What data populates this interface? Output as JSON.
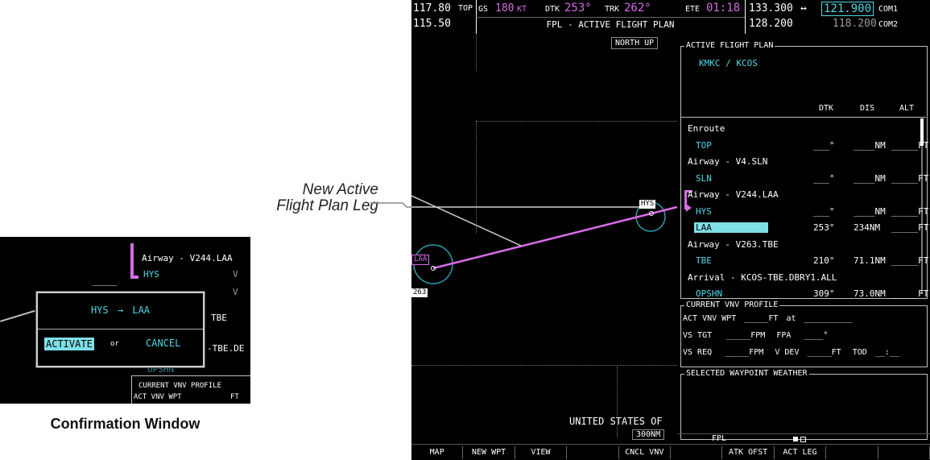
{
  "topbar": {
    "nav1_active": "117.80",
    "nav1_ident": "TOP",
    "nav1_standby": "115.50",
    "gs_label": "GS",
    "gs_value": "180",
    "gs_unit": "KT",
    "dtk_label": "DTK",
    "dtk_value": "253°",
    "trk_label": "TRK",
    "trk_value": "262°",
    "ete_label": "ETE",
    "ete_value": "01:18",
    "page_title": "FPL - ACTIVE FLIGHT PLAN",
    "com1_active": "133.300",
    "swap_symbol": "↔",
    "com1_standby": "121.900",
    "com1_label": "COM1",
    "com2_active": "128.200",
    "com2_standby": "118.200",
    "com2_label": "COM2"
  },
  "map": {
    "orientation": "NORTH UP",
    "region_label": "UNITED STATES OF",
    "range": "300NM",
    "waypoint_hys": "HYS",
    "waypoint_laa": "LAA",
    "airway_263": "263"
  },
  "fpl": {
    "title": "ACTIVE FLIGHT PLAN",
    "route": "KMKC / KCOS",
    "col_dtk": "DTK",
    "col_dis": "DIS",
    "col_alt": "ALT",
    "rows": [
      {
        "kind": "header",
        "name": "Enroute"
      },
      {
        "kind": "wpt",
        "name": "TOP",
        "dtk": "___°",
        "dis": "____NM",
        "alt": "_____FT"
      },
      {
        "kind": "header",
        "name": "Airway - V4.SLN"
      },
      {
        "kind": "wpt",
        "name": "SLN",
        "dtk": "___°",
        "dis": "____NM",
        "alt": "_____FT"
      },
      {
        "kind": "header",
        "name": "Airway - V244.LAA"
      },
      {
        "kind": "wpt",
        "name": "HYS",
        "dtk": "___°",
        "dis": "____NM",
        "alt": "_____FT"
      },
      {
        "kind": "wpt-selected",
        "name": "LAA",
        "dtk": "253°",
        "dis": "234NM",
        "alt": "_____FT"
      },
      {
        "kind": "header",
        "name": "Airway - V263.TBE"
      },
      {
        "kind": "wpt",
        "name": "TBE",
        "dtk": "210°",
        "dis": "71.1NM",
        "alt": "_____FT"
      },
      {
        "kind": "header",
        "name": "Arrival - KCOS-TBE.DBRY1.ALL"
      },
      {
        "kind": "wpt",
        "name": "OPSHN",
        "dtk": "309°",
        "dis": "73.0NM",
        "alt": "_____FT"
      }
    ]
  },
  "vnv": {
    "title": "CURRENT VNV PROFILE",
    "act_vnv_wpt_label": "ACT VNV WPT",
    "act_vnv_wpt_value": "_____FT",
    "at_label": "at",
    "at_value": "__________",
    "vs_tgt_label": "VS TGT",
    "vs_tgt_value": "_____FPM",
    "fpa_label": "FPA",
    "fpa_value": "____°",
    "vs_req_label": "VS REQ",
    "vs_req_value": "_____FPM",
    "vdev_label": "V DEV",
    "vdev_value": "_____FT",
    "tod_label": "TOD",
    "tod_value": "__:__"
  },
  "weather": {
    "title": "SELECTED WAYPOINT WEATHER"
  },
  "status": {
    "mode": "FPL"
  },
  "softkeys": [
    "MAP",
    "NEW WPT",
    "VIEW",
    "",
    "CNCL VNV",
    "",
    "ATK OFST",
    "ACT LEG",
    "",
    ""
  ],
  "inset": {
    "airway_line": "Airway - V244.LAA",
    "hys": "HYS",
    "from_wpt": "HYS",
    "arrow": "→",
    "to_wpt": "LAA",
    "activate": "ACTIVATE",
    "or": "or",
    "cancel": "CANCEL",
    "tbe_partial": "TBE",
    "tbe_db_partial": "-TBE.DE",
    "opshn_partial": "OPSHN",
    "vnv_partial": "CURRENT VNV PROFILE",
    "act_partial": "ACT VNV WPT",
    "ft_partial": "FT",
    "caption": "Confirmation Window"
  },
  "callout": {
    "line1": "New Active",
    "line2": "Flight Plan Leg"
  },
  "colors": {
    "magenta": "#d66be6",
    "cyan": "#4fd8e6",
    "highlight": "#7fe0e8"
  }
}
